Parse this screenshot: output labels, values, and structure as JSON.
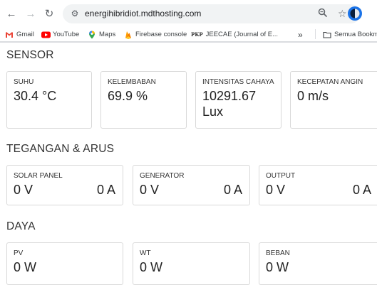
{
  "browser": {
    "url": "energihibridiot.mdthosting.com",
    "bookmarks": [
      {
        "label": "Gmail"
      },
      {
        "label": "YouTube"
      },
      {
        "label": "Maps"
      },
      {
        "label": "Firebase console"
      },
      {
        "label": "JEECAE (Journal of E..."
      },
      {
        "label": "Semua Bookm"
      }
    ],
    "bookmark_overflow": "»"
  },
  "sensor": {
    "title": "SENSOR",
    "cards": [
      {
        "label": "SUHU",
        "value": "30.4 °C"
      },
      {
        "label": "KELEMBABAN",
        "value": "69.9 %"
      },
      {
        "label": "INTENSITAS CAHAYA",
        "value_line1": "10291.67",
        "value_line2": "Lux"
      },
      {
        "label": "KECEPATAN ANGIN",
        "value": "0 m/s"
      }
    ]
  },
  "tegangan": {
    "title": "TEGANGAN & ARUS",
    "cards": [
      {
        "label": "SOLAR PANEL",
        "voltage": "0 V",
        "current": "0 A"
      },
      {
        "label": "GENERATOR",
        "voltage": "0 V",
        "current": "0 A"
      },
      {
        "label": "OUTPUT",
        "voltage": "0 V",
        "current": "0 A"
      }
    ]
  },
  "daya": {
    "title": "DAYA",
    "cards": [
      {
        "label": "PV",
        "value": "0 W"
      },
      {
        "label": "WT",
        "value": "0 W"
      },
      {
        "label": "BEBAN",
        "value": "0 W"
      }
    ]
  }
}
